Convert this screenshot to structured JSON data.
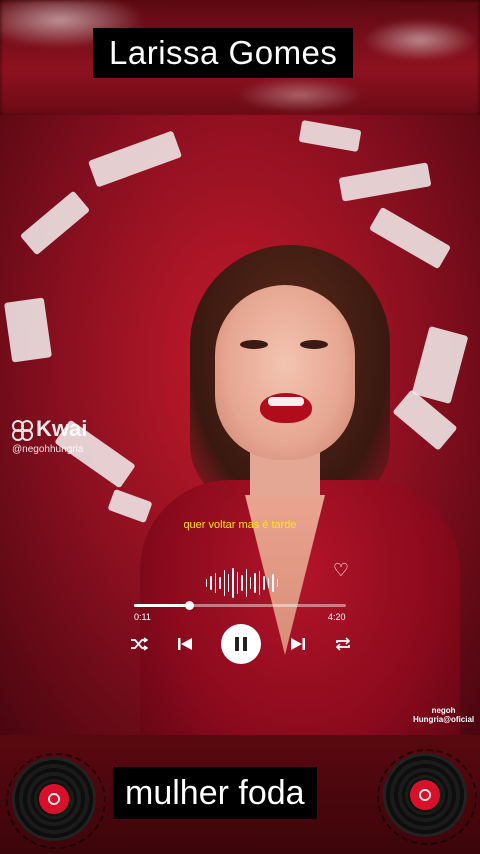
{
  "header": {
    "title": "Larissa Gomes"
  },
  "watermark": {
    "logo_text": "Kwai",
    "handle": "@negohhungria"
  },
  "player": {
    "lyric": "quer voltar mas é tarde",
    "elapsed": "0:11",
    "duration": "4:20",
    "progress": 0.26,
    "icons": [
      "shuffle-icon",
      "previous-icon",
      "pause-icon",
      "next-icon",
      "repeat-icon",
      "heart-icon",
      "waveform-icon"
    ]
  },
  "credit": {
    "line1": "negoh",
    "line2": "Hungria@oficial"
  },
  "caption": {
    "text": "mulher foda"
  },
  "colors": {
    "lyric": "#ffe21a",
    "accent_red": "#b3142a",
    "caption_bg": "#000000"
  }
}
